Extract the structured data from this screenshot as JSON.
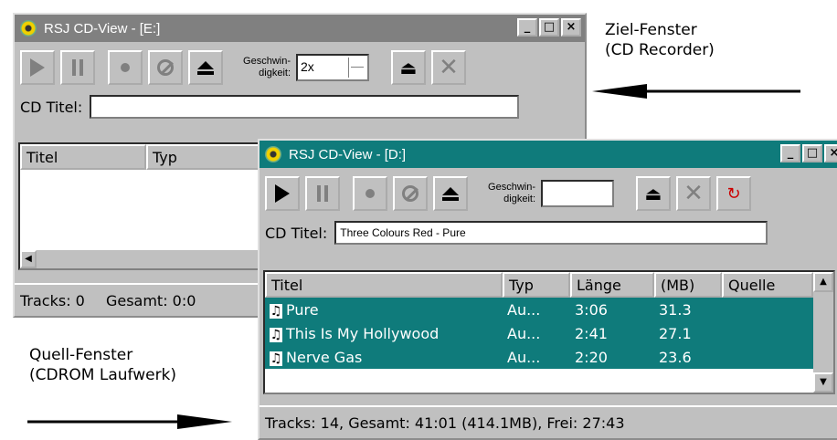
{
  "annotations": {
    "target_window": "Ziel-Fenster\n(CD Recorder)",
    "source_window": "Quell-Fenster\n(CDROM Laufwerk)"
  },
  "back_window": {
    "title": "RSJ CD-View - [E:]",
    "speed_label": "Geschwin-\ndigkeit:",
    "speed_value": "2x",
    "cd_title_label": "CD Titel:",
    "cd_title_value": "",
    "columns": [
      "Titel",
      "Typ"
    ],
    "status_tracks": "Tracks: 0",
    "status_total": "Gesamt: 0:0"
  },
  "front_window": {
    "title": "RSJ CD-View - [D:]",
    "speed_label": "Geschwin-\ndigkeit:",
    "speed_value": "",
    "cd_title_label": "CD Titel:",
    "cd_title_value": "Three Colours Red - Pure",
    "columns": [
      "Titel",
      "Typ",
      "Länge",
      "(MB)",
      "Quelle"
    ],
    "rows": [
      {
        "title": "Pure",
        "type": "Au...",
        "length": "3:06",
        "mb": "31.3",
        "source": ""
      },
      {
        "title": "This Is My Hollywood",
        "type": "Au...",
        "length": "2:41",
        "mb": "27.1",
        "source": ""
      },
      {
        "title": "Nerve Gas",
        "type": "Au...",
        "length": "2:20",
        "mb": "23.6",
        "source": ""
      }
    ],
    "status": "Tracks: 14,  Gesamt: 41:01 (414.1MB),  Frei: 27:43"
  },
  "window_buttons": {
    "minimize": "_",
    "maximize": "□",
    "close": "×"
  },
  "colors": {
    "active_title": "#0f7b7b",
    "inactive_title": "#808080",
    "face": "#c0c0c0"
  }
}
